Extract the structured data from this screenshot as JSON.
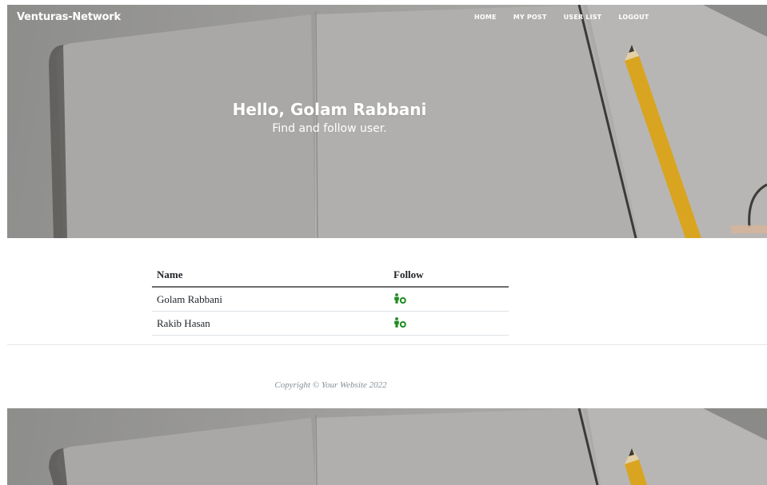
{
  "navbar": {
    "brand": "Venturas-Network",
    "links": [
      "HOME",
      "MY POST",
      "USER LIST",
      "LOGOUT"
    ]
  },
  "hero": {
    "title": "Hello, Golam Rabbani",
    "subtitle": "Find and follow user."
  },
  "table": {
    "headers": [
      "Name",
      "Follow"
    ],
    "rows": [
      {
        "name": "Golam Rabbani",
        "follow_icon": "user-follow-icon"
      },
      {
        "name": "Rakib Hasan",
        "follow_icon": "user-follow-icon"
      }
    ]
  },
  "footer": {
    "copyright": "Copyright © Your Website 2022"
  },
  "colors": {
    "follow_icon": "#1e8a1e",
    "hero_overlay": "#9e9d9b",
    "muted_text": "#868e96"
  }
}
